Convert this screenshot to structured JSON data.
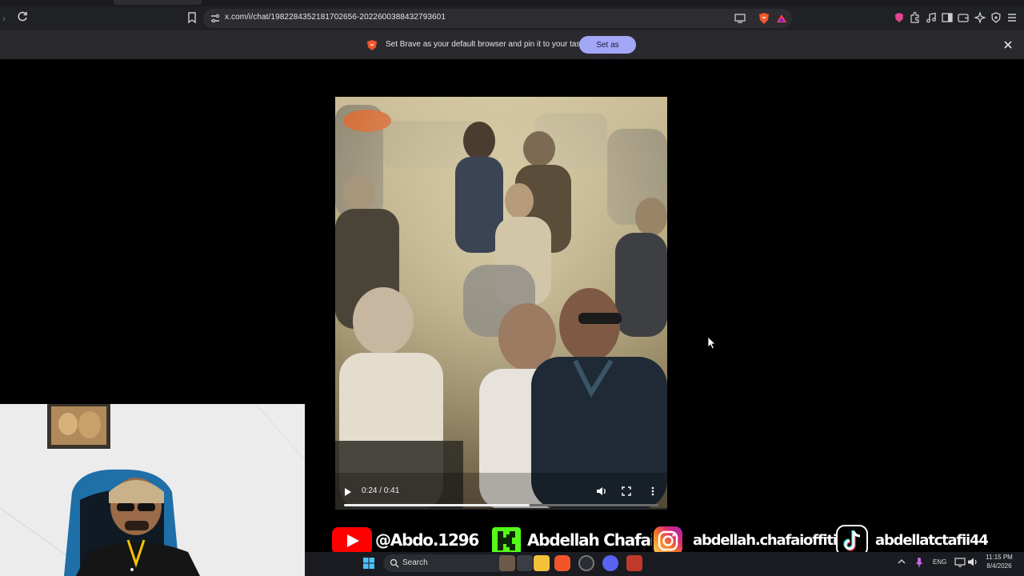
{
  "browser": {
    "url": "x.com/i/chat/1982284352181702656-2022600388432793601"
  },
  "infobar": {
    "message": "Set Brave as your default browser and pin it to your taskbar",
    "button_label": "Set as default"
  },
  "video": {
    "time": "0:24 / 0:41",
    "progress": 0.59
  },
  "social": {
    "youtube": "@Abdo.1296",
    "kick": "Abdellah Chafai",
    "instagram": "abdellah.chafaioffitid",
    "tiktok": "abdellatctafii44"
  },
  "taskbar": {
    "search_label": "Search",
    "language": "ENG",
    "time": "11:15 PM",
    "date": "8/4/2026"
  },
  "colors": {
    "brave_orange": "#f1562b",
    "infobar_button": "#a3a7f7",
    "youtube_red": "#ff0000",
    "kick_green": "#53fc18"
  }
}
